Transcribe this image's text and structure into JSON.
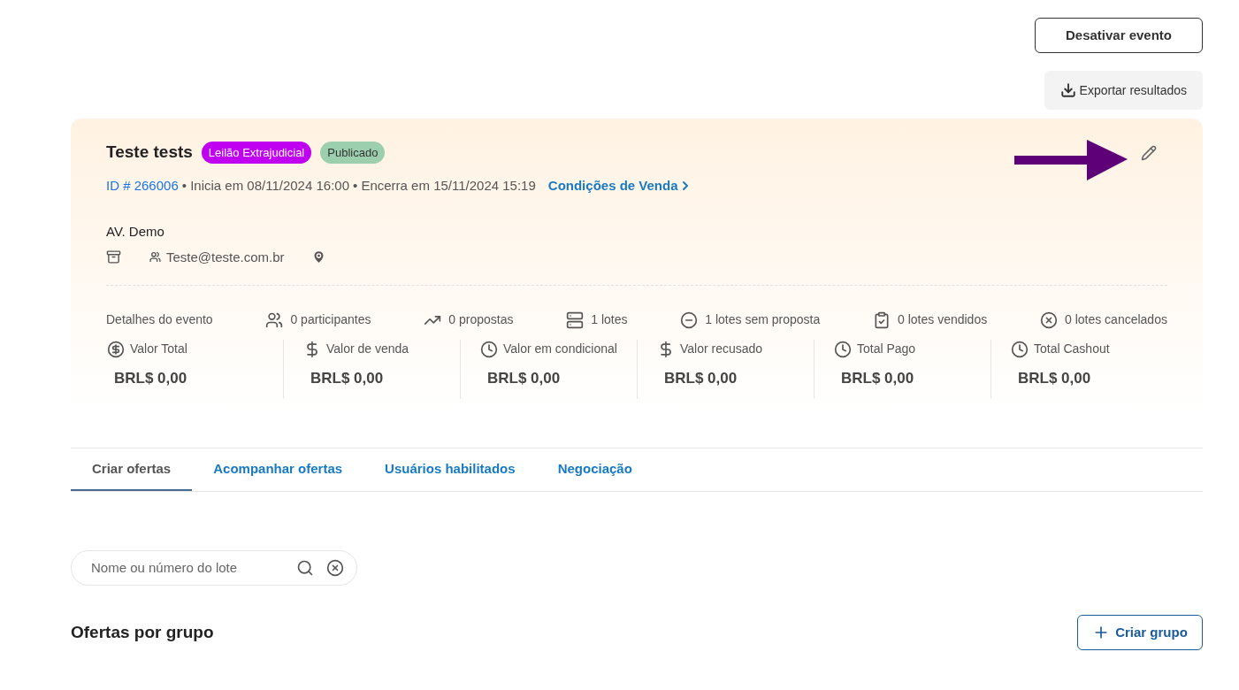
{
  "top_actions": {
    "deactivate": "Desativar evento",
    "export": "Exportar resultados"
  },
  "event": {
    "title": "Teste tests",
    "badges": [
      {
        "label": "Leilão Extrajudicial",
        "color": "#c000f0"
      },
      {
        "label": "Publicado",
        "color": "#9ccfae"
      }
    ],
    "id": "ID # 266006",
    "start": "• Inicia em 08/11/2024 16:00",
    "end": "• Encerra em 15/11/2024 15:19",
    "conditions_link": "Condições de Venda",
    "location": "AV. Demo",
    "contact": "Teste@teste.com.br",
    "details_label": "Detalhes do evento",
    "stats": [
      "0 participantes",
      "0 propostas",
      "1 lotes",
      "1 lotes sem proposta",
      "0 lotes vendidos",
      "0 lotes cancelados"
    ],
    "totals": [
      {
        "label": "Valor Total",
        "value": "BRL$ 0,00"
      },
      {
        "label": "Valor de venda",
        "value": "BRL$ 0,00"
      },
      {
        "label": "Valor em condicional",
        "value": "BRL$ 0,00"
      },
      {
        "label": "Valor recusado",
        "value": "BRL$ 0,00"
      },
      {
        "label": "Total Pago",
        "value": "BRL$ 0,00"
      },
      {
        "label": "Total Cashout",
        "value": "BRL$ 0,00"
      }
    ]
  },
  "tabs": [
    {
      "label": "Criar ofertas",
      "selected": true
    },
    {
      "label": "Acompanhar ofertas",
      "selected": false
    },
    {
      "label": "Usuários habilitados",
      "selected": false
    },
    {
      "label": "Negociação",
      "selected": false
    }
  ],
  "search": {
    "placeholder": "Nome ou número do lote"
  },
  "groups": {
    "title": "Ofertas por grupo",
    "create_button": "Criar grupo"
  }
}
